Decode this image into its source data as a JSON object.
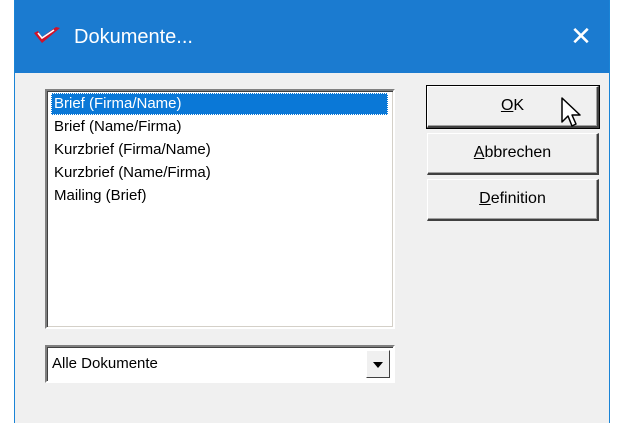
{
  "window": {
    "title": "Dokumente...",
    "close_glyph": "✕",
    "title_icon": "checkmark-logo-icon"
  },
  "list": {
    "items": [
      {
        "label": "Brief (Firma/Name)",
        "selected": true
      },
      {
        "label": "Brief (Name/Firma)",
        "selected": false
      },
      {
        "label": "Kurzbrief (Firma/Name)",
        "selected": false
      },
      {
        "label": "Kurzbrief (Name/Firma)",
        "selected": false
      },
      {
        "label": "Mailing (Brief)",
        "selected": false
      }
    ]
  },
  "filter": {
    "selected": "Alle Dokumente"
  },
  "buttons": {
    "ok": {
      "mnemonic": "O",
      "rest": "K"
    },
    "cancel": {
      "mnemonic": "A",
      "rest": "bbrechen"
    },
    "definition": {
      "mnemonic": "D",
      "rest": "efinition"
    }
  },
  "colors": {
    "titlebar": "#1b7bd0",
    "selection": "#0a78d7",
    "dialog_bg": "#f0f0f0",
    "logo": "#d0122a"
  }
}
